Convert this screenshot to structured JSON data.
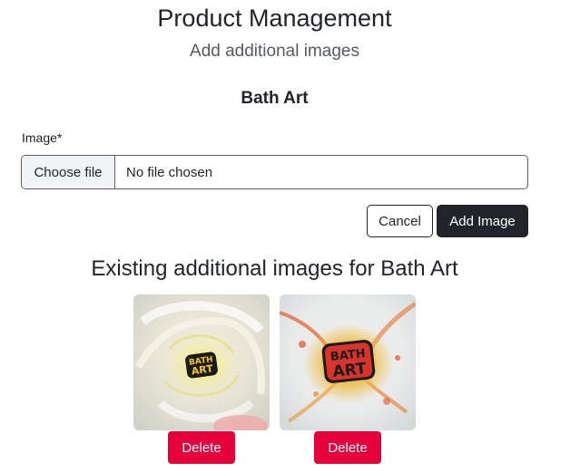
{
  "header": {
    "title": "Product Management",
    "subtitle": "Add additional images"
  },
  "product": {
    "name": "Bath Art"
  },
  "form": {
    "image_label": "Image*",
    "choose_file_label": "Choose file",
    "file_status": "No file chosen",
    "cancel_label": "Cancel",
    "add_image_label": "Add Image"
  },
  "existing": {
    "heading": "Existing additional images for Bath Art",
    "images": [
      {
        "logo_text": "BATH ART",
        "delete_label": "Delete"
      },
      {
        "logo_text": "BATH ART",
        "delete_label": "Delete"
      }
    ]
  },
  "colors": {
    "primary_dark": "#212529",
    "danger": "#e5003c"
  }
}
